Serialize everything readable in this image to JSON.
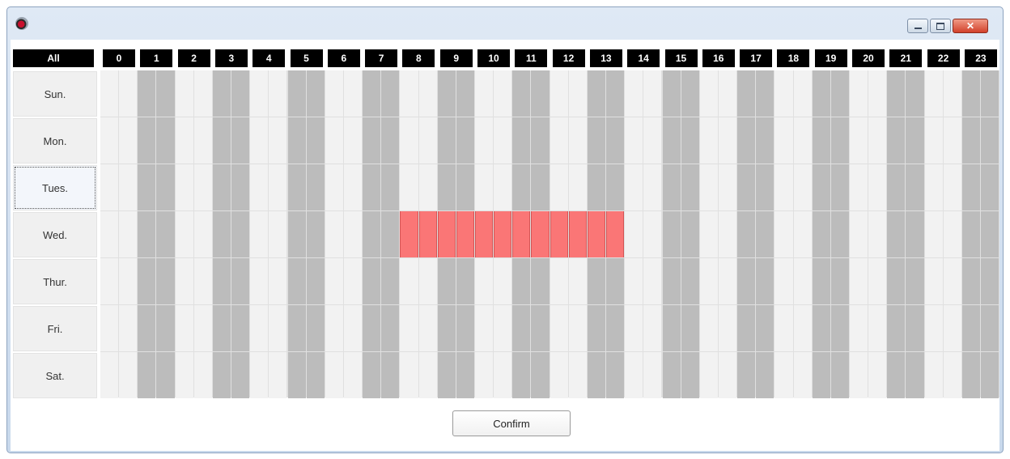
{
  "header": {
    "all_label": "All",
    "hours": [
      "0",
      "1",
      "2",
      "3",
      "4",
      "5",
      "6",
      "7",
      "8",
      "9",
      "10",
      "11",
      "12",
      "13",
      "14",
      "15",
      "16",
      "17",
      "18",
      "19",
      "20",
      "21",
      "22",
      "23"
    ]
  },
  "days": [
    "Sun.",
    "Mon.",
    "Tues.",
    "Wed.",
    "Thur.",
    "Fri.",
    "Sat."
  ],
  "focused_day": "Tues.",
  "schedule": {
    "slots_per_hour": 2,
    "selected": [
      {
        "day": "Wed.",
        "from_hour": 8,
        "to_hour": 14
      }
    ]
  },
  "footer": {
    "confirm_label": "Confirm"
  },
  "colors": {
    "header_bg": "#000000",
    "cell_light": "#f2f2f2",
    "cell_dark": "#bcbcbc",
    "selected": "#fa7676",
    "title_bar": "#dfe9f5"
  },
  "window_controls": {
    "minimize_icon": "minimize-icon",
    "maximize_icon": "maximize-icon",
    "close_icon": "close-icon"
  }
}
